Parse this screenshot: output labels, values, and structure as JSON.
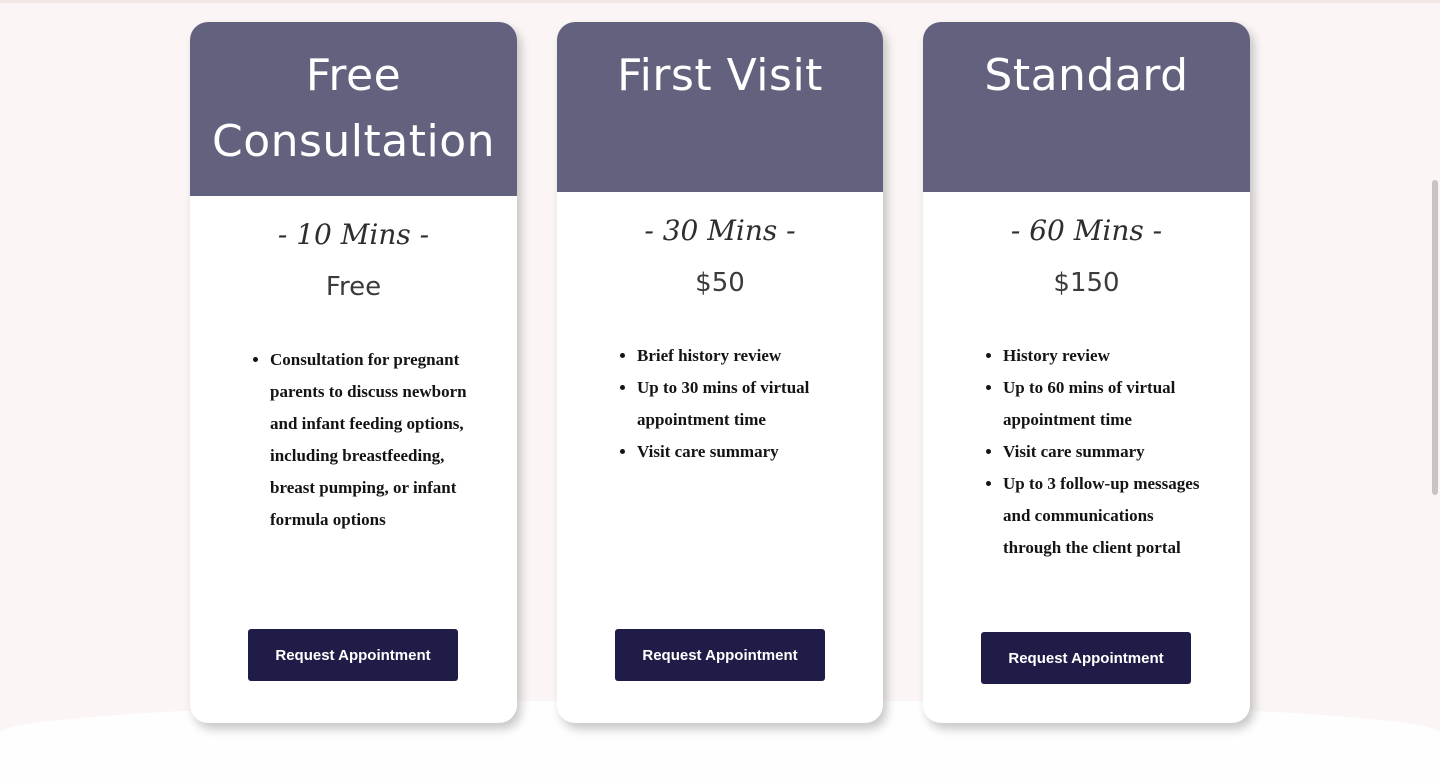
{
  "plans": [
    {
      "title_line1": "Free",
      "title_line2": "Consultation",
      "duration": "- 10 Mins -",
      "price": "Free",
      "features": [
        "Consultation for pregnant parents to discuss newborn and infant feeding options, including breastfeeding, breast pumping, or infant formula options"
      ],
      "button_label": "Request Appointment"
    },
    {
      "title_line1": "First Visit",
      "title_line2": "",
      "duration": "- 30 Mins -",
      "price": "$50",
      "features": [
        "Brief history review",
        "Up to 30 mins of virtual appointment time",
        "Visit care summary"
      ],
      "button_label": "Request Appointment"
    },
    {
      "title_line1": "Standard",
      "title_line2": "",
      "duration": "- 60 Mins -",
      "price": "$150",
      "features": [
        "History review",
        "Up to 60 mins of virtual appointment time",
        "Visit care summary",
        "Up to 3 follow-up messages and communications through the client portal"
      ],
      "button_label": "Request Appointment"
    }
  ],
  "colors": {
    "header_bg": "#63627e",
    "button_bg": "#1f1d47",
    "page_bg": "#fbf6f5"
  }
}
